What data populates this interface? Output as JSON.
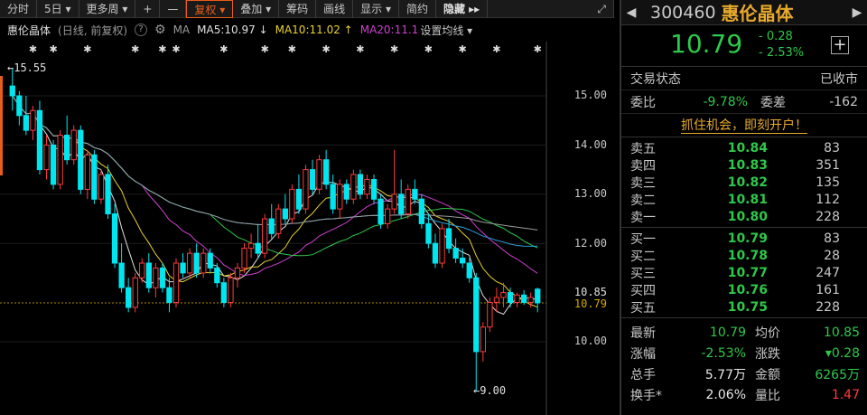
{
  "toolbar": {
    "items": [
      "分时",
      "5日 ▾",
      "更多周 ▾",
      "+",
      "—",
      "复权 ▾",
      "叠加 ▾",
      "筹码",
      "画线",
      "显示 ▾",
      "简约",
      "隐藏 ▸▸",
      "⤢"
    ]
  },
  "chart_header": {
    "name": "惠伦晶体",
    "period": "(日线, 前复权)",
    "help": "?",
    "ma_label": "MA",
    "ma5": "MA5:10.97 ↓",
    "ma10": "MA10:11.02 ↑",
    "ma20": "MA20:11.1",
    "set_ma": "设置均线 ▾"
  },
  "colors": {
    "up": "#ff3b3b",
    "down": "#00e6f0",
    "ma5": "#e0e0e0",
    "ma10": "#e8d230",
    "ma20": "#d040d0",
    "ma30": "#2ec84a",
    "ma60": "#2a9fd8",
    "ma120": "#9a9a9a",
    "accent": "#e85d1a"
  },
  "annotations": {
    "high": "←15.55",
    "low": "←9.00"
  },
  "price_axis": [
    "15.00",
    "14.00",
    "13.00",
    "12.00",
    "10.85",
    "10.79",
    "10.00"
  ],
  "panel": {
    "code": "300460",
    "name": "惠伦晶体",
    "price": "10.79",
    "change": "- 0.28",
    "change_pct": "- 2.53%",
    "status_label": "交易状态",
    "status_value": "已收市",
    "weibi_label": "委比",
    "weibi_value": "-9.78%",
    "weicha_label": "委差",
    "weicha_value": "-162",
    "promo": "抓住机会，即刻开户！",
    "asks": [
      {
        "label": "卖五",
        "price": "10.84",
        "vol": "83"
      },
      {
        "label": "卖四",
        "price": "10.83",
        "vol": "351"
      },
      {
        "label": "卖三",
        "price": "10.82",
        "vol": "135"
      },
      {
        "label": "卖二",
        "price": "10.81",
        "vol": "112"
      },
      {
        "label": "卖一",
        "price": "10.80",
        "vol": "228"
      }
    ],
    "bids": [
      {
        "label": "买一",
        "price": "10.79",
        "vol": "83"
      },
      {
        "label": "买二",
        "price": "10.78",
        "vol": "28"
      },
      {
        "label": "买三",
        "price": "10.77",
        "vol": "247"
      },
      {
        "label": "买四",
        "price": "10.76",
        "vol": "161"
      },
      {
        "label": "买五",
        "price": "10.75",
        "vol": "228"
      }
    ],
    "stats": [
      {
        "l1": "最新",
        "v1": "10.79",
        "l2": "均价",
        "v2": "10.85"
      },
      {
        "l1": "涨幅",
        "v1": "-2.53%",
        "l2": "涨跌",
        "v2": "▾0.28"
      },
      {
        "l1": "总手",
        "v1": "5.77万",
        "l2": "金额",
        "v2": "6265万"
      },
      {
        "l1": "换手*",
        "v1": "2.06%",
        "l2": "量比",
        "v2": "1.47"
      }
    ]
  },
  "chart_data": {
    "type": "candlestick",
    "title": "",
    "ylim": [
      9.0,
      16.0
    ],
    "yticks": [
      15.0,
      14.0,
      13.0,
      12.0,
      10.0
    ],
    "current": 10.79,
    "candles": [
      [
        15.2,
        15.55,
        14.7,
        15.0
      ],
      [
        15.0,
        15.1,
        14.4,
        14.6
      ],
      [
        14.6,
        15.0,
        14.2,
        14.3
      ],
      [
        14.3,
        14.8,
        14.1,
        14.7
      ],
      [
        14.7,
        14.9,
        13.4,
        13.5
      ],
      [
        13.5,
        14.2,
        13.3,
        14.0
      ],
      [
        14.0,
        14.1,
        13.1,
        13.2
      ],
      [
        13.2,
        14.3,
        13.1,
        14.2
      ],
      [
        14.2,
        14.6,
        13.6,
        13.7
      ],
      [
        13.7,
        14.4,
        13.6,
        14.3
      ],
      [
        14.3,
        14.4,
        13.0,
        13.1
      ],
      [
        13.1,
        13.9,
        12.9,
        13.8
      ],
      [
        13.8,
        13.9,
        12.8,
        12.9
      ],
      [
        12.9,
        13.5,
        12.8,
        13.4
      ],
      [
        13.4,
        13.6,
        12.5,
        12.6
      ],
      [
        12.6,
        12.8,
        11.5,
        11.6
      ],
      [
        11.6,
        12.0,
        11.0,
        11.1
      ],
      [
        11.1,
        11.3,
        10.6,
        10.7
      ],
      [
        10.7,
        11.4,
        10.6,
        11.3
      ],
      [
        11.3,
        11.7,
        11.2,
        11.6
      ],
      [
        11.6,
        11.8,
        11.0,
        11.1
      ],
      [
        11.1,
        11.6,
        10.9,
        11.5
      ],
      [
        11.5,
        11.6,
        11.0,
        11.1
      ],
      [
        11.1,
        11.3,
        10.6,
        10.8
      ],
      [
        10.8,
        11.7,
        10.7,
        11.6
      ],
      [
        11.6,
        11.8,
        11.3,
        11.4
      ],
      [
        11.4,
        11.9,
        11.3,
        11.8
      ],
      [
        11.8,
        12.0,
        11.3,
        11.4
      ],
      [
        11.4,
        11.9,
        11.3,
        11.8
      ],
      [
        11.8,
        11.9,
        11.4,
        11.5
      ],
      [
        11.5,
        11.6,
        11.1,
        11.2
      ],
      [
        11.2,
        11.3,
        10.7,
        10.8
      ],
      [
        10.8,
        11.4,
        10.7,
        11.3
      ],
      [
        11.3,
        11.6,
        11.1,
        11.5
      ],
      [
        11.5,
        12.0,
        11.4,
        11.9
      ],
      [
        11.9,
        12.2,
        11.7,
        12.0
      ],
      [
        12.0,
        12.4,
        11.7,
        11.8
      ],
      [
        11.8,
        12.6,
        11.7,
        12.5
      ],
      [
        12.5,
        12.8,
        12.1,
        12.2
      ],
      [
        12.2,
        12.8,
        12.1,
        12.7
      ],
      [
        12.7,
        13.0,
        12.4,
        12.5
      ],
      [
        12.5,
        13.2,
        12.4,
        13.1
      ],
      [
        13.1,
        13.4,
        12.6,
        12.7
      ],
      [
        12.7,
        13.6,
        12.6,
        13.5
      ],
      [
        13.5,
        13.7,
        13.0,
        13.1
      ],
      [
        13.1,
        13.8,
        13.0,
        13.7
      ],
      [
        13.7,
        13.9,
        13.1,
        13.2
      ],
      [
        13.2,
        13.4,
        12.6,
        12.7
      ],
      [
        12.7,
        13.3,
        12.5,
        13.2
      ],
      [
        13.2,
        13.3,
        12.8,
        12.9
      ],
      [
        12.9,
        13.5,
        12.8,
        13.4
      ],
      [
        13.4,
        13.5,
        12.9,
        13.0
      ],
      [
        13.0,
        13.4,
        12.9,
        13.3
      ],
      [
        13.3,
        13.4,
        12.8,
        12.9
      ],
      [
        12.9,
        13.0,
        12.3,
        12.4
      ],
      [
        12.4,
        12.8,
        12.3,
        12.7
      ],
      [
        12.7,
        13.9,
        12.6,
        13.0
      ],
      [
        13.0,
        13.3,
        12.5,
        12.6
      ],
      [
        12.6,
        13.2,
        12.5,
        13.1
      ],
      [
        13.1,
        13.3,
        12.8,
        12.9
      ],
      [
        12.9,
        13.0,
        12.3,
        12.4
      ],
      [
        12.4,
        12.6,
        11.9,
        12.0
      ],
      [
        12.0,
        12.2,
        11.5,
        11.6
      ],
      [
        11.6,
        12.4,
        11.5,
        12.3
      ],
      [
        12.3,
        12.5,
        11.8,
        11.9
      ],
      [
        11.9,
        12.1,
        11.6,
        11.7
      ],
      [
        11.7,
        11.9,
        11.5,
        11.6
      ],
      [
        11.6,
        11.7,
        11.2,
        11.3
      ],
      [
        11.3,
        11.4,
        9.0,
        9.8
      ],
      [
        9.8,
        10.4,
        9.6,
        10.3
      ],
      [
        10.3,
        10.9,
        10.2,
        10.8
      ],
      [
        10.8,
        11.1,
        10.6,
        10.9
      ],
      [
        10.9,
        11.2,
        10.7,
        11.0
      ],
      [
        11.0,
        11.1,
        10.7,
        10.8
      ],
      [
        10.8,
        11.0,
        10.7,
        10.95
      ],
      [
        10.95,
        11.05,
        10.75,
        10.8
      ],
      [
        10.8,
        11.0,
        10.7,
        10.9
      ],
      [
        11.07,
        11.1,
        10.6,
        10.79
      ]
    ]
  }
}
